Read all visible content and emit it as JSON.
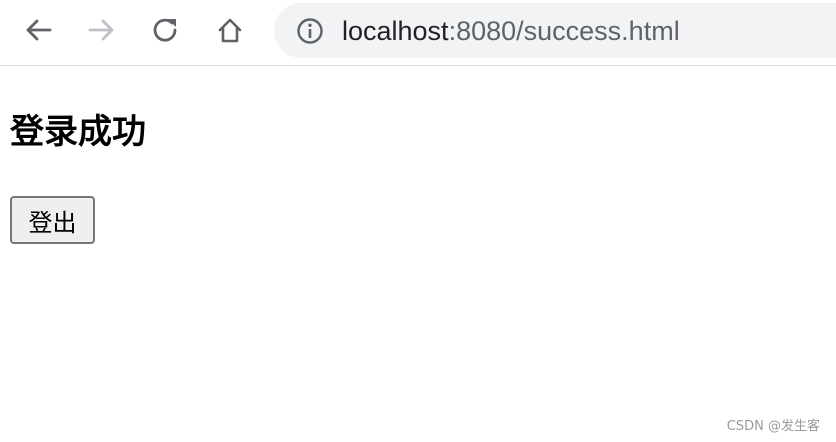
{
  "browser": {
    "url_host": "localhost",
    "url_path": ":8080/success.html"
  },
  "page": {
    "title": "登录成功",
    "logout_label": "登出"
  },
  "watermark": "CSDN @发生客",
  "icons": {
    "back": "arrow-left-icon",
    "forward": "arrow-right-icon",
    "reload": "reload-icon",
    "home": "home-icon",
    "site_info": "info-icon"
  },
  "colors": {
    "icon_active": "#5f6368",
    "icon_disabled": "#bdc1c6",
    "omnibox_bg": "#f1f3f4"
  }
}
